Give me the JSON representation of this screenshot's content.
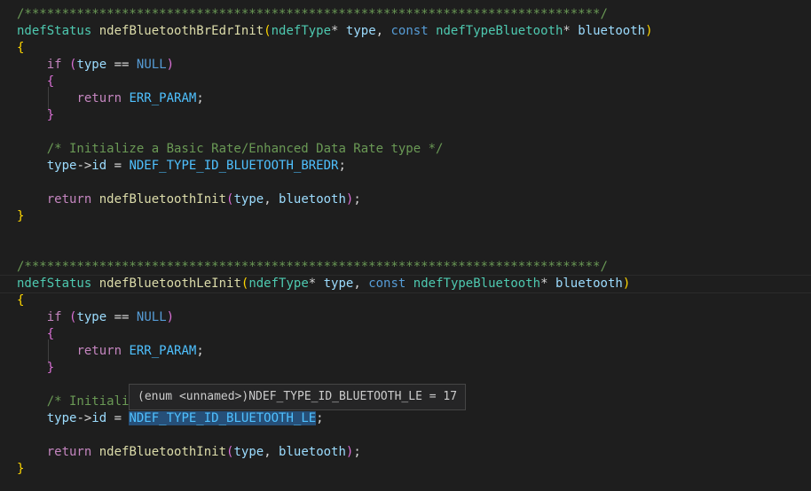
{
  "code": {
    "block1": {
      "separator": "/*****************************************************************************/",
      "sig_type": "ndefStatus",
      "sig_name": "ndefBluetoothBrEdrInit",
      "param1_type": "ndefType",
      "param1_name": "type",
      "const_kw": "const",
      "param2_type": "ndefTypeBluetooth",
      "param2_name": "bluetooth",
      "if_kw": "if",
      "if_var": "type",
      "if_op": "==",
      "null_kw": "NULL",
      "return_kw": "return",
      "err_const": "ERR_PARAM",
      "comment": "/* Initialize a Basic Rate/Enhanced Data Rate type */",
      "assign_var": "type",
      "assign_field": "id",
      "assign_const": "NDEF_TYPE_ID_BLUETOOTH_BREDR",
      "call_fn": "ndefBluetoothInit",
      "call_arg1": "type",
      "call_arg2": "bluetooth"
    },
    "block2": {
      "separator": "/*****************************************************************************/",
      "sig_type": "ndefStatus",
      "sig_name": "ndefBluetoothLeInit",
      "param1_type": "ndefType",
      "param1_name": "type",
      "const_kw": "const",
      "param2_type": "ndefTypeBluetooth",
      "param2_name": "bluetooth",
      "if_kw": "if",
      "if_var": "type",
      "if_op": "==",
      "null_kw": "NULL",
      "return_kw": "return",
      "err_const": "ERR_PARAM",
      "comment_partial": "/* Initiali",
      "assign_var": "type",
      "assign_field": "id",
      "assign_const": "NDEF_TYPE_ID_BLUETOOTH_LE",
      "call_fn": "ndefBluetoothInit",
      "call_arg1": "type",
      "call_arg2": "bluetooth"
    }
  },
  "hover_tooltip": {
    "text": "(enum <unnamed>)NDEF_TYPE_ID_BLUETOOTH_LE = 17"
  },
  "colors": {
    "background": "#1e1e1e",
    "comment": "#6a9955",
    "type": "#4ec9b0",
    "function": "#dcdcaa",
    "keyword": "#569cd6",
    "control": "#c586c0",
    "parameter": "#9cdcfe",
    "enum_constant": "#4fc1ff",
    "bracket_level1": "#ffd700",
    "bracket_level2": "#da70d6",
    "bracket_level3": "#179fff",
    "selection_highlight": "#264f78"
  }
}
